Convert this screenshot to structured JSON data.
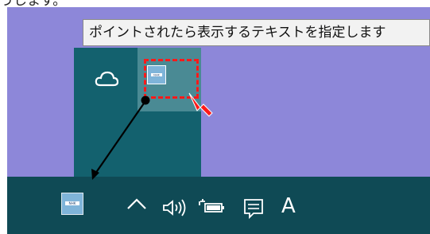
{
  "heading_fragment": "うします。",
  "tooltip": {
    "text": "ポイントされたら表示するテキストを指定します"
  },
  "app_icon": {
    "label": "NHK"
  },
  "taskbar": {
    "ime_mode": "A"
  },
  "colors": {
    "desktop": "#8d87d9",
    "taskbar": "#0f4a55",
    "overflow_panel": "#13616e",
    "highlight_red": "#ff1a1a",
    "tooltip_bg": "#f2f2f2"
  },
  "icons": [
    "cloud-icon",
    "app-icon",
    "chevron-up-icon",
    "volume-icon",
    "battery-icon",
    "notification-icon"
  ]
}
